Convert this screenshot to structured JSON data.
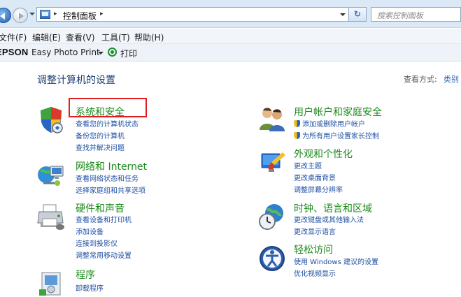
{
  "address_bar": {
    "path_separator": "▸",
    "path": "控制面板",
    "refresh_icon": "refresh-icon",
    "search_placeholder": "搜索控制面板"
  },
  "menu": {
    "items": [
      {
        "label": "文件(F)"
      },
      {
        "label": "编辑(E)"
      },
      {
        "label": "查看(V)"
      },
      {
        "label": "工具(T)"
      },
      {
        "label": "帮助(H)"
      }
    ]
  },
  "toolbar": {
    "brand": "EPSON",
    "app_name": "Easy Photo Print",
    "print_label": "打印"
  },
  "content": {
    "title": "调整计算机的设置",
    "view_label": "查看方式:",
    "view_value": "类别",
    "accent_color": "#1b8a1b",
    "link_color": "#1f4fa3"
  },
  "categories_left": [
    {
      "title": "系统和安全",
      "icon": "shield-icon",
      "links": [
        "查看您的计算机状态",
        "备份您的计算机",
        "查找并解决问题"
      ]
    },
    {
      "title": "网络和 Internet",
      "icon": "network-icon",
      "links": [
        "查看网络状态和任务",
        "选择家庭组和共享选项"
      ]
    },
    {
      "title": "硬件和声音",
      "icon": "printer-icon",
      "links": [
        "查看设备和打印机",
        "添加设备",
        "连接到投影仪",
        "调整常用移动设置"
      ]
    },
    {
      "title": "程序",
      "icon": "programs-icon",
      "links": [
        "卸载程序"
      ]
    }
  ],
  "categories_right": [
    {
      "title": "用户帐户和家庭安全",
      "icon": "users-icon",
      "links": [
        "添加或删除用户帐户",
        "为所有用户设置家长控制"
      ]
    },
    {
      "title": "外观和个性化",
      "icon": "appearance-icon",
      "links": [
        "更改主题",
        "更改桌面背景",
        "调整屏幕分辨率"
      ]
    },
    {
      "title": "时钟、语言和区域",
      "icon": "clock-globe-icon",
      "links": [
        "更改键盘或其他输入法",
        "更改显示语言"
      ]
    },
    {
      "title": "轻松访问",
      "icon": "accessibility-icon",
      "links": [
        "使用 Windows 建议的设置",
        "优化视频显示"
      ]
    }
  ]
}
